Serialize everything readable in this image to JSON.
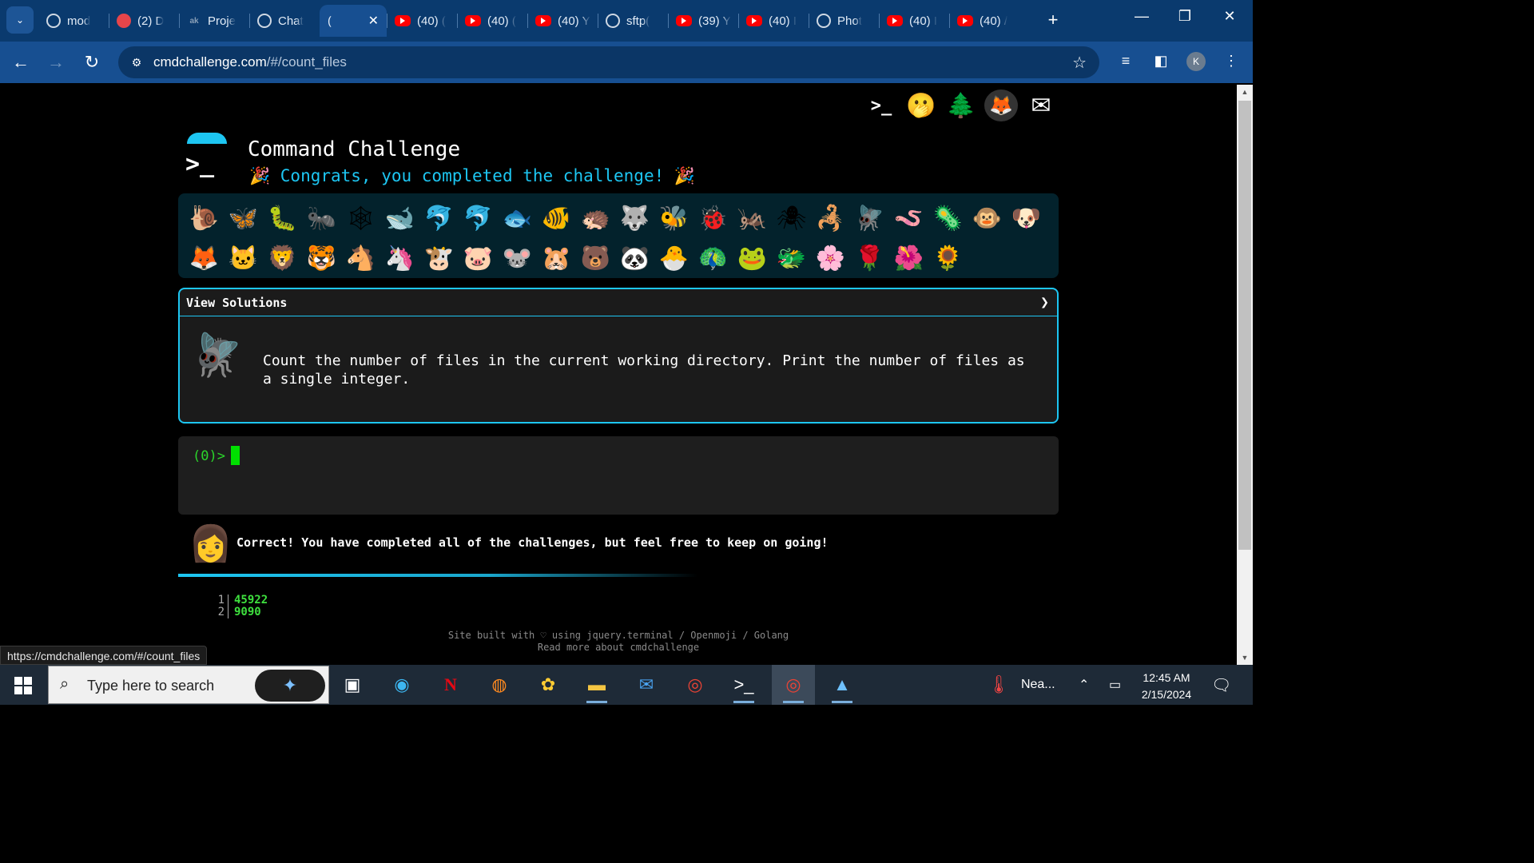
{
  "browser": {
    "tabs": [
      {
        "label": "mod",
        "icon": "circle-icon",
        "kind": "circle"
      },
      {
        "label": "(2) D",
        "icon": "discord-icon",
        "kind": "d2"
      },
      {
        "label": "Proje",
        "icon": "ak-icon",
        "kind": "ak"
      },
      {
        "label": "Chat",
        "icon": "chatgpt-icon",
        "kind": "circle"
      },
      {
        "label": "(",
        "icon": "terminal-icon",
        "kind": "term",
        "active": true
      },
      {
        "label": "(40) (",
        "icon": "youtube-icon",
        "kind": "yt"
      },
      {
        "label": "(40) (",
        "icon": "youtube-icon",
        "kind": "yt"
      },
      {
        "label": "(40) Y",
        "icon": "youtube-icon",
        "kind": "yt"
      },
      {
        "label": "sftp(",
        "icon": "circle-icon",
        "kind": "circle"
      },
      {
        "label": "(39) Y",
        "icon": "youtube-icon",
        "kind": "yt"
      },
      {
        "label": "(40) I",
        "icon": "youtube-icon",
        "kind": "yt"
      },
      {
        "label": "Phot",
        "icon": "chatgpt-icon",
        "kind": "circle"
      },
      {
        "label": "(40) I",
        "icon": "youtube-icon",
        "kind": "yt"
      },
      {
        "label": "(40) /",
        "icon": "youtube-icon",
        "kind": "yt"
      }
    ],
    "ak_text": "ak",
    "term_text": ">_",
    "url_host": "cmdchallenge.com",
    "url_path": "/#/count_files",
    "profile_initial": "K",
    "status_url": "https://cmdchallenge.com/#/count_files"
  },
  "page": {
    "title": "Command Challenge",
    "congrats": "🎉 Congrats, you completed the challenge! 🎉",
    "header_icons": [
      ">_",
      "🫢",
      "🌲",
      "🦊",
      "✉"
    ],
    "emojis_row1": [
      "🐌",
      "🦋",
      "🐛",
      "🐜",
      "🕸",
      "🐋",
      "🐬",
      "🐬",
      "🐟",
      "🐠",
      "🦔",
      "🐺",
      "🐝",
      "🐞",
      "🦗",
      "🕷",
      "🦂",
      "🪰",
      "🪱",
      "🦠",
      "🐵",
      "🐶"
    ],
    "emojis_row2": [
      "🦊",
      "🐱",
      "🦁",
      "🐯",
      "🐴",
      "🦄",
      "🐮",
      "🐷",
      "🐭",
      "🐹",
      "🐻",
      "🐼",
      "🐣",
      "🦚",
      "🐸",
      "🐲",
      "🌸",
      "🌹",
      "🌺",
      "🌻"
    ],
    "view_solutions": "View Solutions",
    "chevron": "❯",
    "fly": "🪰",
    "task": "Count the number of files in the current working directory. Print the number of files as a single integer.",
    "prompt": "(0)>",
    "feedback_icon": "👩",
    "feedback": "Correct! You have completed all of the challenges, but feel free to keep on going!",
    "output_lines": [
      {
        "n": "1",
        "v": "45922"
      },
      {
        "n": "2",
        "v": "9090"
      }
    ],
    "footer_line1": "Site built with ♡ using jquery.terminal / Openmoji / Golang",
    "footer_line2": "Read more about cmdchallenge"
  },
  "taskbar": {
    "search_placeholder": "Type here to search",
    "weather": "Nea...",
    "time": "12:45 AM",
    "date": "2/15/2024"
  },
  "colors": {
    "accent": "#1dc6f2",
    "terminal_green": "#2bd52b",
    "chrome_blue": "#174f91"
  }
}
